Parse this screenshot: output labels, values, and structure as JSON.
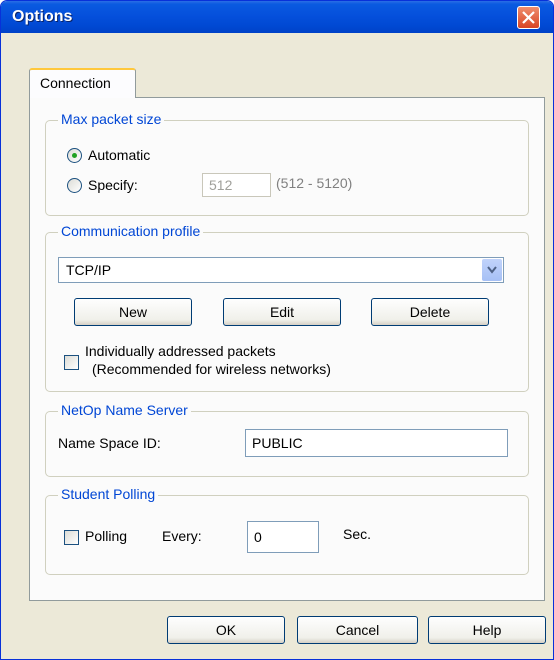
{
  "window": {
    "title": "Options"
  },
  "tabs": [
    {
      "label": "Connection"
    }
  ],
  "max_packet": {
    "title": "Max packet size",
    "automatic_label": "Automatic",
    "specify_label": "Specify:",
    "specify_value": "512",
    "range_hint": "(512 - 5120)",
    "selected": "Automatic"
  },
  "profile": {
    "title": "Communication profile",
    "selected_value": "TCP/IP",
    "new_label": "New",
    "edit_label": "Edit",
    "delete_label": "Delete",
    "individual_line1": "Individually addressed packets",
    "individual_line2": "(Recommended for wireless networks)",
    "individual_checked": false
  },
  "name_server": {
    "title": "NetOp Name Server",
    "namespace_label": "Name Space ID:",
    "namespace_value": "PUBLIC"
  },
  "polling": {
    "title": "Student Polling",
    "polling_label": "Polling",
    "polling_checked": false,
    "every_label": "Every:",
    "every_value": "0",
    "unit_label": "Sec."
  },
  "footer": {
    "ok_label": "OK",
    "cancel_label": "Cancel",
    "help_label": "Help"
  }
}
